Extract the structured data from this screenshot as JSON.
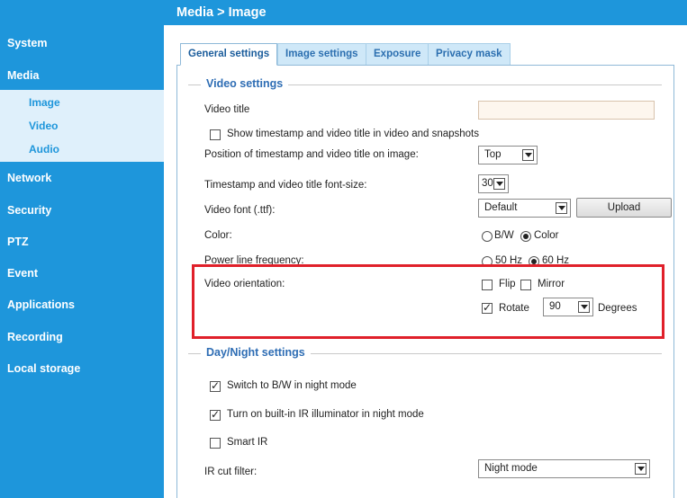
{
  "header": {
    "breadcrumb": "Media  > Image"
  },
  "sidebar": {
    "items": [
      {
        "label": "System"
      },
      {
        "label": "Media"
      },
      {
        "label": "Network"
      },
      {
        "label": "Security"
      },
      {
        "label": "PTZ"
      },
      {
        "label": "Event"
      },
      {
        "label": "Applications"
      },
      {
        "label": "Recording"
      },
      {
        "label": "Local storage"
      }
    ],
    "media_subitems": [
      {
        "label": "Image"
      },
      {
        "label": "Video"
      },
      {
        "label": "Audio"
      }
    ]
  },
  "tabs": [
    {
      "label": "General settings",
      "active": true
    },
    {
      "label": "Image settings",
      "active": false
    },
    {
      "label": "Exposure",
      "active": false
    },
    {
      "label": "Privacy mask",
      "active": false
    }
  ],
  "video_settings": {
    "title": "Video settings",
    "video_title_label": "Video title",
    "video_title_value": "",
    "show_timestamp_label": "Show timestamp and video title in video and snapshots",
    "show_timestamp_checked": false,
    "position_label": "Position of timestamp and video title on image:",
    "position_value": "Top",
    "font_size_label": "Timestamp and video title font-size:",
    "font_size_value": "30",
    "video_font_label": "Video font (.ttf):",
    "video_font_value": "Default",
    "upload_label": "Upload",
    "color_label": "Color:",
    "color_options": [
      "B/W",
      "Color"
    ],
    "color_selected": "Color",
    "power_line_label": "Power line frequency:",
    "power_line_options": [
      "50 Hz",
      "60 Hz"
    ],
    "power_line_selected": "60 Hz",
    "orientation_label": "Video orientation:",
    "flip_label": "Flip",
    "flip_checked": false,
    "mirror_label": "Mirror",
    "mirror_checked": false,
    "rotate_label": "Rotate",
    "rotate_checked": true,
    "rotate_value": "90",
    "degrees_label": "Degrees"
  },
  "day_night": {
    "title": "Day/Night settings",
    "switch_bw_label": "Switch to B/W in night mode",
    "switch_bw_checked": true,
    "ir_illuminator_label": "Turn on built-in IR illuminator in night mode",
    "ir_illuminator_checked": true,
    "smart_ir_label": "Smart IR",
    "smart_ir_checked": false,
    "ir_cut_label": "IR cut filter:",
    "ir_cut_value": "Night mode"
  },
  "colors": {
    "sidebar_bg": "#1e96db",
    "submenu_bg": "#dff0fb",
    "section_title": "#2e6db4",
    "highlight_border": "#e0202a"
  }
}
